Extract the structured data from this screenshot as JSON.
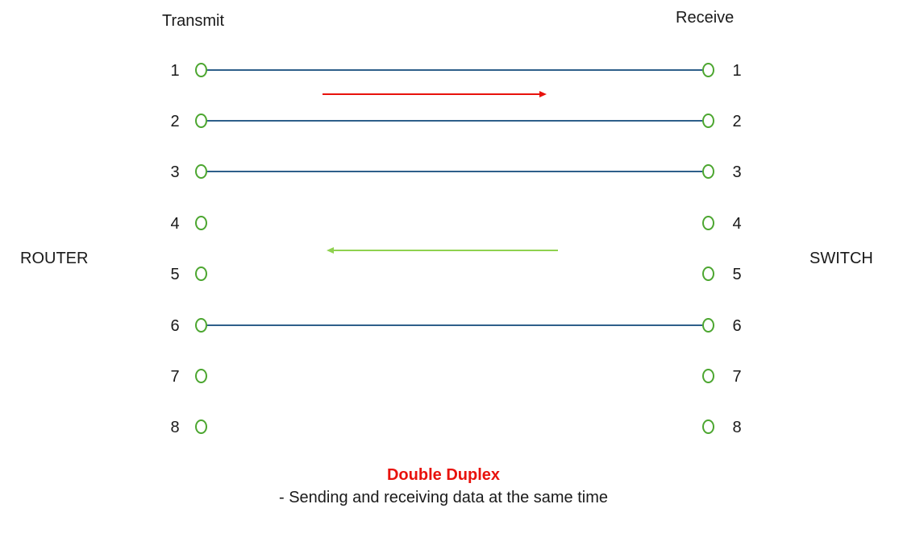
{
  "headers": {
    "left": "Transmit",
    "right": "Receive"
  },
  "devices": {
    "left": "ROUTER",
    "right": "SWITCH"
  },
  "pins": [
    {
      "number": "1",
      "connected": true
    },
    {
      "number": "2",
      "connected": true
    },
    {
      "number": "3",
      "connected": true
    },
    {
      "number": "4",
      "connected": false
    },
    {
      "number": "5",
      "connected": false
    },
    {
      "number": "6",
      "connected": true
    },
    {
      "number": "7",
      "connected": false
    },
    {
      "number": "8",
      "connected": false
    }
  ],
  "arrows": [
    {
      "direction": "right",
      "color": "#e8120c"
    },
    {
      "direction": "left",
      "color": "#8fd14f"
    }
  ],
  "colors": {
    "wire": "#2e5f8a",
    "pin_outline": "#4ca630",
    "caption_title": "#e8120c"
  },
  "caption": {
    "title": "Double Duplex",
    "subtitle": "- Sending and receiving data at the same time"
  }
}
